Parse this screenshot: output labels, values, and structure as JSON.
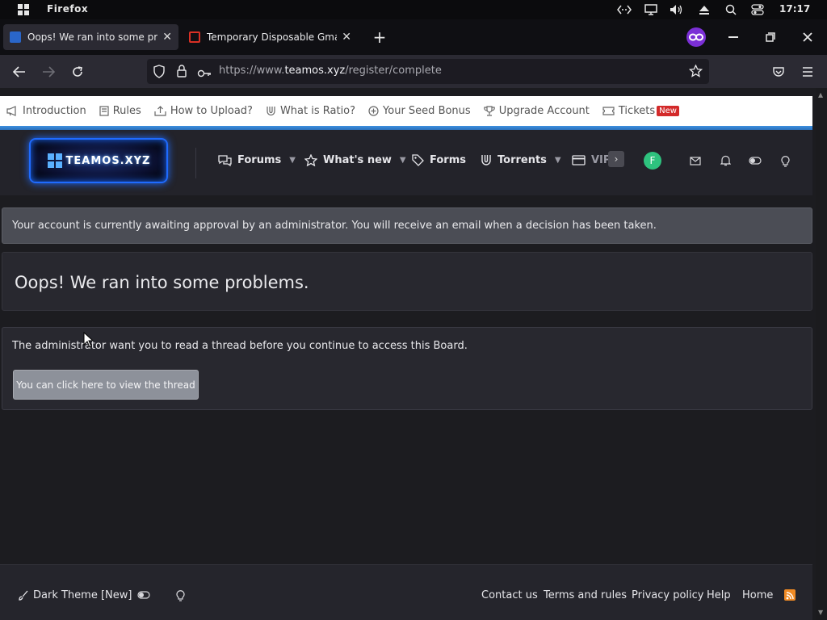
{
  "os": {
    "app_name": "Firefox",
    "clock": "17:17"
  },
  "tabs": [
    {
      "title": "Oops! We ran into some proble",
      "active": true
    },
    {
      "title": "Temporary Disposable Gmail | Te",
      "active": false
    }
  ],
  "navbar": {
    "url_prefix": "https://www.",
    "url_domain": "teamos.xyz",
    "url_path": "/register/complete"
  },
  "top_nav": {
    "items": [
      "Introduction",
      "Rules",
      "How to Upload?",
      "What is Ratio?",
      "Your Seed Bonus",
      "Upgrade Account",
      "Tickets"
    ],
    "badge": "New"
  },
  "header": {
    "logo_text": "TEAMOS.XYZ",
    "nav": [
      "Forums",
      "What's new",
      "Forms",
      "Torrents",
      "VIP"
    ],
    "avatar_letter": "F"
  },
  "notice": {
    "text": "Your account is currently awaiting approval by an administrator. You will receive an email when a decision has been taken."
  },
  "problems": {
    "title": "Oops! We ran into some problems."
  },
  "block": {
    "text": "The administrator want you to read a thread before you continue to access this Board.",
    "button_label": "You can click here to view the thread"
  },
  "footer": {
    "theme_label": "Dark Theme [New]",
    "links": [
      "Contact us",
      "Terms and rules",
      "Privacy policy",
      "Help",
      "Home"
    ]
  },
  "colors": {
    "page_bg": "#1c1c20",
    "accent_blue": "#3d8fe0",
    "badge_red": "#d32a2a",
    "avatar_green": "#2ec27e",
    "rss_orange": "#f08a24"
  }
}
